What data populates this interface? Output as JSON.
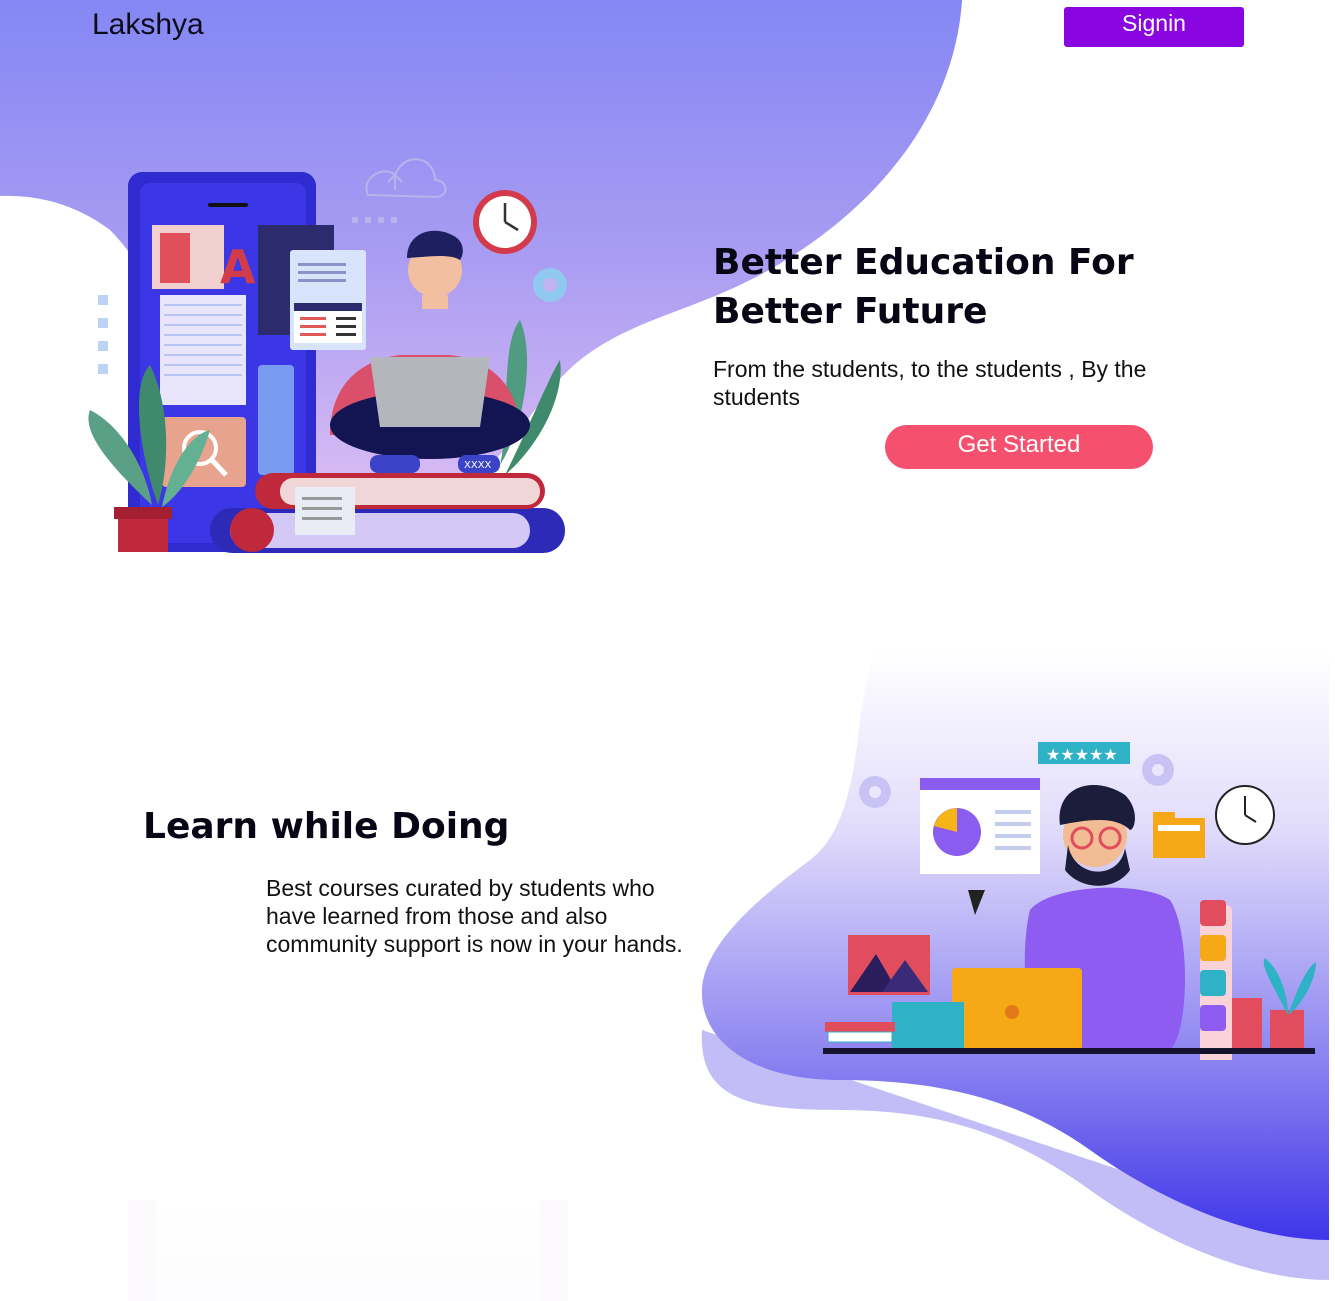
{
  "brand": {
    "name": "Lakshya"
  },
  "header": {
    "signin_label": "Signin"
  },
  "hero": {
    "title": "Better Education For Better Future",
    "subtitle": "From the students, to the students , By the students",
    "cta_label": "Get Started"
  },
  "section_learn": {
    "title": "Learn while Doing",
    "text": "Best courses curated by students who have learned from those and also community support is now in your hands."
  },
  "illustration_labels": {
    "book_tag": "XXXX"
  },
  "icons": [
    "cloud-upload-icon",
    "clock-icon",
    "gear-icon",
    "magnifier-icon",
    "star-rating-icon",
    "pie-chart-icon",
    "folder-icon",
    "globe-icon",
    "phone-icon",
    "location-pin-icon"
  ],
  "colors": {
    "hero_blob_top": "#8487f4",
    "hero_blob_bottom": "#d4b6f2",
    "signin_button": "#8a06e0",
    "cta_button": "#f5516e",
    "blob2_top": "#ffffff",
    "blob2_bottom": "#4338ec"
  }
}
